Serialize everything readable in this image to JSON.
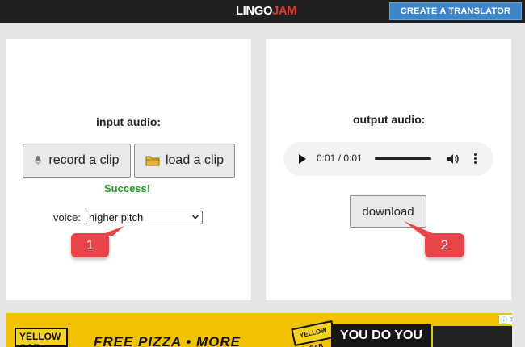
{
  "header": {
    "logo_part1": "LINGO",
    "logo_part2": "JAM",
    "create_button": "CREATE A TRANSLATOR"
  },
  "input_panel": {
    "title": "input audio:",
    "record_button": "record a clip",
    "load_button": "load a clip",
    "status": "Success!",
    "voice_label": "voice:",
    "voice_selected": "higher pitch"
  },
  "output_panel": {
    "title": "output audio:",
    "time_display": "0:01 / 0:01",
    "download_button": "download"
  },
  "callouts": {
    "first": "1",
    "second": "2"
  },
  "ad": {
    "sign_text": "YELLOW CAB",
    "promo_text": "FREE PIZZA • MORE",
    "logo_text": "YELLOW CAB",
    "slogan": "YOU DO YOU",
    "choice_icons": [
      "info-icon",
      "close-icon"
    ]
  },
  "colors": {
    "topbar": "#1f1f1f",
    "accent_button": "#3f86c9",
    "success": "#1f9a1f",
    "callout": "#e8454a",
    "ad_background": "#f2c200"
  }
}
